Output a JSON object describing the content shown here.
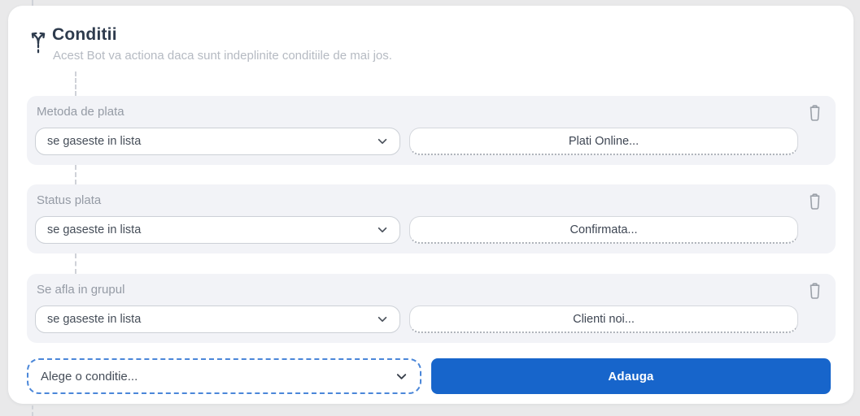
{
  "colors": {
    "accent_blue": "#1765cb",
    "page_bg": "#e9e9ea",
    "card_bg": "#f2f3f7",
    "title_text": "#2e3b4d",
    "muted_text": "#b5bac2",
    "label_text": "#959ba5"
  },
  "header": {
    "icon": "branch-split-icon",
    "title": "Conditii",
    "subtitle": "Acest Bot va actiona daca sunt indeplinite conditiile de mai jos."
  },
  "conditions": [
    {
      "label": "Metoda de plata",
      "operator_selected": "se gaseste in lista",
      "value": "Plati Online...",
      "delete_icon": "trash-icon",
      "dropdown_icon": "chevron-down-icon"
    },
    {
      "label": "Status plata",
      "operator_selected": "se gaseste in lista",
      "value": "Confirmata...",
      "delete_icon": "trash-icon",
      "dropdown_icon": "chevron-down-icon"
    },
    {
      "label": "Se afla in grupul",
      "operator_selected": "se gaseste in lista",
      "value": "Clienti noi...",
      "delete_icon": "trash-icon",
      "dropdown_icon": "chevron-down-icon"
    }
  ],
  "add_row": {
    "select_placeholder": "Alege o conditie...",
    "dropdown_icon": "chevron-down-icon",
    "add_button_label": "Adauga"
  }
}
